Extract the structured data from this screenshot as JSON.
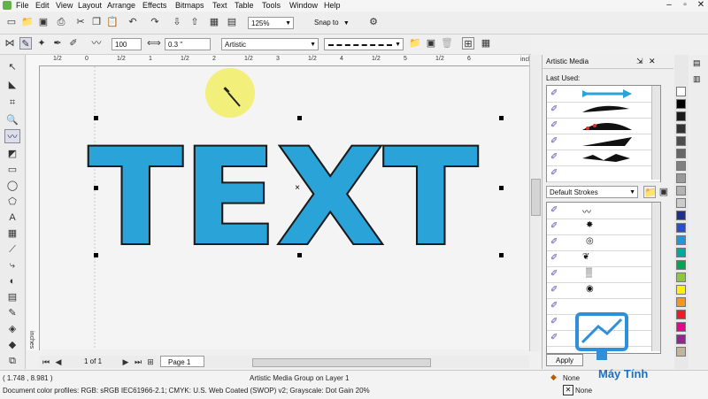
{
  "menu": [
    "File",
    "Edit",
    "View",
    "Layout",
    "Arrange",
    "Effects",
    "Bitmaps",
    "Text",
    "Table",
    "Tools",
    "Window",
    "Help"
  ],
  "toolbar": {
    "zoom": "125%",
    "snap_to": "Snap to"
  },
  "propertybar": {
    "width_value": "100",
    "smoothing_value": "0.3 \"",
    "stroke_preset": "Artistic"
  },
  "ruler": {
    "h_labels": [
      "1/2",
      "0",
      "1/2",
      "1",
      "1/2",
      "2",
      "1/2",
      "3",
      "1/2",
      "4",
      "1/2",
      "5",
      "1/2",
      "6"
    ],
    "units": "inches",
    "v_unit": "inches"
  },
  "canvas": {
    "art_text": "TEXT"
  },
  "docker": {
    "title": "Artistic Media",
    "last_used_label": "Last Used:",
    "category": "Default Strokes",
    "apply_label": "Apply"
  },
  "page_nav": {
    "page_counter": "1 of 1",
    "page_tab": "Page 1"
  },
  "status": {
    "coords": "( 1.748 , 8.981 )",
    "object_info": "Artistic Media Group on Layer 1",
    "profiles": "Document color profiles: RGB: sRGB IEC61966-2.1; CMYK: U.S. Web Coated (SWOP) v2; Grayscale: Dot Gain 20%",
    "fill_label": "None",
    "fill_color": "None",
    "watermark": "Máy Tính"
  },
  "palette": [
    "#ffffff",
    "#000000",
    "#1a1a1a",
    "#333333",
    "#4d4d4d",
    "#666666",
    "#808080",
    "#999999",
    "#b3b3b3",
    "#cccccc",
    "#1f2f8f",
    "#2850c8",
    "#1a9bd7",
    "#00a99d",
    "#00a651",
    "#8dc63f",
    "#fff200",
    "#f7941d",
    "#ed1c24",
    "#ec008c",
    "#92278f",
    "#c2b59b"
  ],
  "colors": {
    "accent": "#2aa3d8",
    "outline": "#1a1a1a",
    "sun": "#f2ef7a"
  }
}
